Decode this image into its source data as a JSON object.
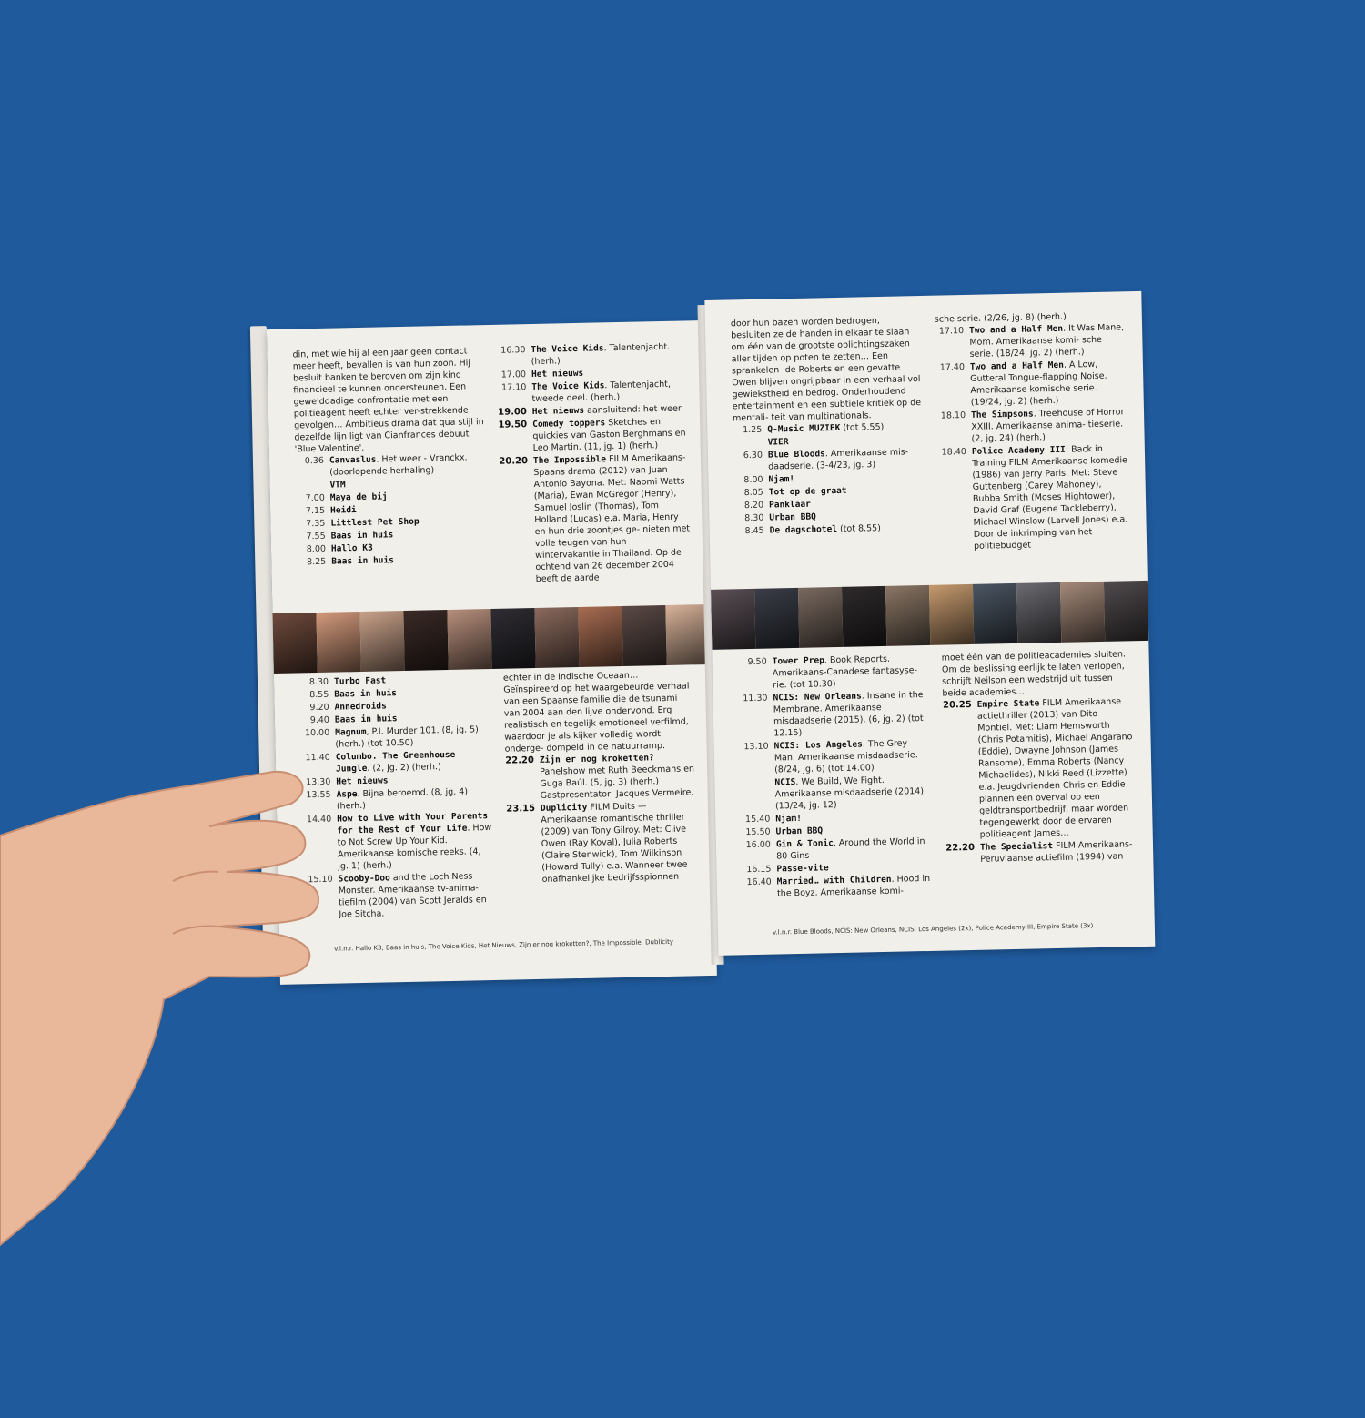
{
  "left_page": {
    "col1_top_intro": "din, met wie hij al een jaar geen contact meer heeft, bevallen is van hun zoon. Hij besluit banken te beroven om zijn kind financieel te kunnen ondersteunen. Een gewelddadige confrontatie met een politieagent heeft echter ver-strekkende gevolgen… Ambitieus drama dat qua stijl in dezelfde lijn ligt van Cianfrances debuut 'Blue Valentine'.",
    "col1_top": [
      {
        "time": "0.36",
        "title": "Canvaslus",
        "text": ". Het weer - Vranckx. (doorlopende herhaling)"
      },
      {
        "time": "",
        "title": "VTM",
        "text": ""
      },
      {
        "time": "7.00",
        "title": "Maya de bij",
        "text": ""
      },
      {
        "time": "7.15",
        "title": "Heidi",
        "text": ""
      },
      {
        "time": "7.35",
        "title": "Littlest Pet Shop",
        "text": ""
      },
      {
        "time": "7.55",
        "title": "Baas in huis",
        "text": ""
      },
      {
        "time": "8.00",
        "title": "Hallo K3",
        "text": ""
      },
      {
        "time": "8.25",
        "title": "Baas in huis",
        "text": ""
      }
    ],
    "col2_top": [
      {
        "time": "16.30",
        "title": "The Voice Kids",
        "text": ". Talentenjacht. (herh.)"
      },
      {
        "time": "17.00",
        "title": "Het nieuws",
        "text": ""
      },
      {
        "time": "17.10",
        "title": "The Voice Kids",
        "text": ". Talentenjacht, tweede deel. (herh.)"
      },
      {
        "time": "19.00",
        "title": "Het nieuws",
        "text": " aansluitend: het weer."
      },
      {
        "time": "19.50",
        "title": "Comedy toppers",
        "text": " Sketches en quickies van Gaston Berghmans en Leo Martin. (11, jg. 1) (herh.)"
      },
      {
        "time": "20.20",
        "title": "The Impossible",
        "text": " FILM Amerikaans-Spaans drama (2012) van Juan Antonio Bayona. Met: Naomi Watts (Maria), Ewan McGregor (Henry), Samuel Joslin (Thomas), Tom Holland (Lucas) e.a. Maria, Henry en hun drie zoontjes ge- nieten met volle teugen van hun wintervakantie in Thailand. Op de ochtend van 26 december 2004 beeft de aarde"
      }
    ],
    "col1_bottom": [
      {
        "time": "8.30",
        "title": "Turbo Fast",
        "text": ""
      },
      {
        "time": "8.55",
        "title": "Baas in huis",
        "text": ""
      },
      {
        "time": "9.20",
        "title": "Annedroids",
        "text": ""
      },
      {
        "time": "9.40",
        "title": "Baas in huis",
        "text": ""
      },
      {
        "time": "10.00",
        "title": "Magnum",
        "text": ", P.I. Murder 101. (8, jg. 5) (herh.) (tot 10.50)"
      },
      {
        "time": "11.40",
        "title": "Columbo. The Greenhouse Jungle",
        "text": ". (2, jg. 2) (herh.)"
      },
      {
        "time": "13.30",
        "title": "Het nieuws",
        "text": ""
      },
      {
        "time": "13.55",
        "title": "Aspe",
        "text": ". Bijna beroemd. (8, jg. 4) (herh.)"
      },
      {
        "time": "14.40",
        "title": "How to Live with Your Parents for the Rest of Your Life",
        "text": ". How to Not Screw Up Your Kid. Amerikaanse komische reeks. (4, jg. 1) (herh.)"
      },
      {
        "time": "15.10",
        "title": "Scooby-Doo",
        "text": " and the Loch Ness Monster. Amerikaanse tv-anima-tiefilm (2004) van Scott Jeralds en Joe Sitcha."
      }
    ],
    "col2_bottom_intro": "echter in de Indische Oceaan… Geïnspireerd op het waargebeurde verhaal van een Spaanse familie die de tsunami van 2004 aan den lijve ondervond. Erg realistisch en tegelijk emotioneel verfilmd, waardoor je als kijker volledig wordt onderge- dompeld in de natuurramp.",
    "col2_bottom": [
      {
        "time": "22.20",
        "title": "Zijn er nog kroketten?",
        "text": " Panelshow met Ruth Beeckmans en Guga Baúl. (5, jg. 3) (herh.) Gastpresentator: Jacques Vermeire."
      },
      {
        "time": "23.15",
        "title": "Duplicity",
        "text": " FILM Duits — Amerikaanse romantische thriller (2009) van Tony Gilroy. Met: Clive Owen (Ray Koval), Julia Roberts (Claire Stenwick), Tom Wilkinson (Howard Tully) e.a. Wanneer twee onafhankelijke bedrijfsspionnen"
      }
    ],
    "caption": "v.l.n.r. Hallo K3, Baas in huis, The Voice Kids, Het Nieuws, Zijn er nog kroketten?, The Impossible, Dublicity"
  },
  "right_page": {
    "col1_top_intro": "door hun bazen worden bedrogen, besluiten ze de handen in elkaar te slaan om één van de grootste oplichtingszaken aller tijden op poten te zetten… Een sprankelen- de Roberts en een gevatte Owen blijven ongrijpbaar in een verhaal vol gewiekstheid en bedrog. Onderhoudend entertainment en een subtiele kritiek op de mentali- teit van multinationals.",
    "col1_top": [
      {
        "time": "1.25",
        "title": "Q-Music MUZIEK",
        "text": " (tot 5.55)"
      },
      {
        "time": "",
        "title": "VIER",
        "text": ""
      },
      {
        "time": "6.30",
        "title": "Blue Bloods",
        "text": ". Amerikaanse mis- daadserie. (3-4/23, jg. 3)"
      },
      {
        "time": "8.00",
        "title": "Njam!",
        "text": ""
      },
      {
        "time": "8.05",
        "title": "Tot op de graat",
        "text": ""
      },
      {
        "time": "8.20",
        "title": "Panklaar",
        "text": ""
      },
      {
        "time": "8.30",
        "title": "Urban BBQ",
        "text": ""
      },
      {
        "time": "8.45",
        "title": "De dagschotel",
        "text": " (tot 8.55)"
      }
    ],
    "col2_top_intro": "sche serie. (2/26, jg. 8) (herh.)",
    "col2_top": [
      {
        "time": "17.10",
        "title": "Two and a Half Men",
        "text": ". It Was Mane, Mom. Amerikaanse komi- sche serie. (18/24, jg. 2) (herh.)"
      },
      {
        "time": "17.40",
        "title": "Two and a Half Men",
        "text": ". A Low, Gutteral Tongue-flapping Noise. Amerikaanse komische serie. (19/24, jg. 2) (herh.)"
      },
      {
        "time": "18.10",
        "title": "The Simpsons",
        "text": ". Treehouse of Horror XXIII. Amerikaanse anima- tieserie. (2, jg. 24) (herh.)"
      },
      {
        "time": "18.40",
        "title": "Police Academy III",
        "text": ": Back in Training FILM Amerikaanse komedie (1986) van Jerry Paris. Met: Steve Guttenberg (Carey Mahoney), Bubba Smith (Moses Hightower), David Graf (Eugene Tackleberry), Michael Winslow (Larvell Jones) e.a. Door de inkrimping van het politiebudget"
      }
    ],
    "col1_bottom": [
      {
        "time": "9.50",
        "title": "Tower Prep",
        "text": ". Book Reports. Amerikaans-Canadese fantasyse- rie. (tot 10.30)"
      },
      {
        "time": "11.30",
        "title": "NCIS: New Orleans",
        "text": ". Insane in the Membrane. Amerikaanse misdaadserie (2015). (6, jg. 2) (tot 12.15)"
      },
      {
        "time": "13.10",
        "title": "NCIS: Los Angeles",
        "text": ". The Grey Man. Amerikaanse misdaadserie. (8/24, jg. 6) (tot 14.00)"
      },
      {
        "time": "",
        "title": "NCIS",
        "text": ". We Build, We Fight. Amerikaanse misdaadserie (2014). (13/24, jg. 12)"
      },
      {
        "time": "15.40",
        "title": "Njam!",
        "text": ""
      },
      {
        "time": "15.50",
        "title": "Urban BBQ",
        "text": ""
      },
      {
        "time": "16.00",
        "title": "Gin & Tonic",
        "text": ", Around the World in 80 Gins"
      },
      {
        "time": "16.15",
        "title": "Passe-vite",
        "text": ""
      },
      {
        "time": "16.40",
        "title": "Married… with Children",
        "text": ". Hood in the Boyz. Amerikaanse komi-"
      }
    ],
    "col2_bottom_intro": "moet één van de politieacademies sluiten. Om de beslissing eerlijk te laten verlopen, schrijft Neilson een wedstrijd uit tussen beide academies…",
    "col2_bottom": [
      {
        "time": "20.25",
        "title": "Empire State",
        "text": " FILM Amerikaanse actiethriller (2013) van Dito Montiel. Met: Liam Hemsworth (Chris Potamitis), Michael Angarano (Eddie), Dwayne Johnson (James Ransome), Emma Roberts (Nancy Michaelides), Nikki Reed (Lizzette) e.a. Jeugdvrienden Chris en Eddie plannen een overval op een geldtransportbedrijf, maar worden tegengewerkt door de ervaren politieagent James…"
      },
      {
        "time": "22.20",
        "title": "The Specialist",
        "text": " FILM Amerikaans-Peruviaanse actiefilm (1994) van"
      }
    ],
    "caption": "v.l.n.r. Blue Bloods, NCIS: New Orleans, NCIS: Los Angeles (2x), Police Academy III, Empire State (3x)"
  },
  "colors": {
    "background": "#1f5a9c",
    "paper": "#f1efea",
    "text": "#222222",
    "skin": "#e9b79a"
  },
  "photo_strip_left": [
    "#6e4a3c",
    "#d39a7c",
    "#c9a28a",
    "#3a2a26",
    "#b78f7c",
    "#2f2d33",
    "#8b6a5d",
    "#a86d52",
    "#5b4a46",
    "#d8b39a"
  ],
  "photo_strip_right": [
    "#5a4f55",
    "#3b3e48",
    "#7a6a60",
    "#2e2a2c",
    "#8a7665",
    "#c59a6e",
    "#4b5663",
    "#6b6a70",
    "#a58a7a",
    "#514b4e"
  ]
}
